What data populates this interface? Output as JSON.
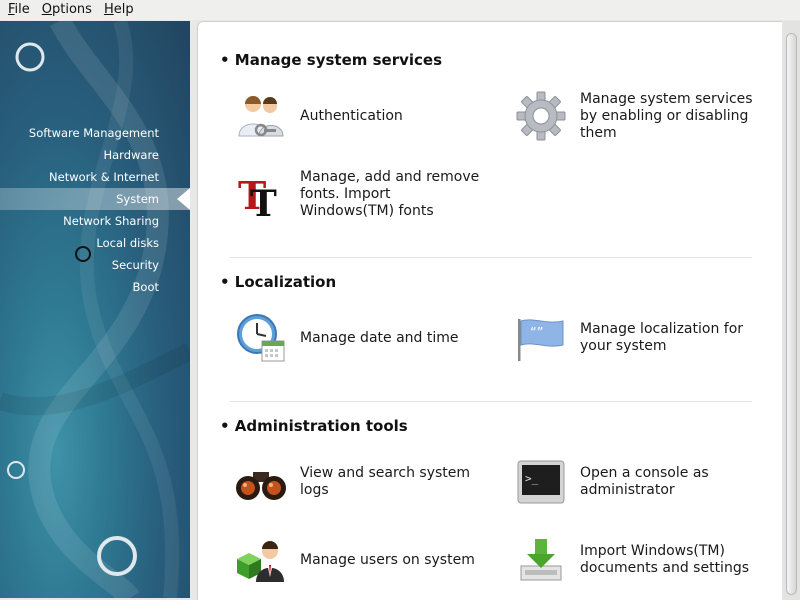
{
  "menubar": {
    "items": [
      {
        "mnemonic": "F",
        "rest": "ile"
      },
      {
        "mnemonic": "O",
        "rest": "ptions"
      },
      {
        "mnemonic": "H",
        "rest": "elp"
      }
    ]
  },
  "sidebar": {
    "items": [
      {
        "label": "Software Management"
      },
      {
        "label": "Hardware"
      },
      {
        "label": "Network & Internet"
      },
      {
        "label": "System",
        "active": true
      },
      {
        "label": "Network Sharing"
      },
      {
        "label": "Local disks"
      },
      {
        "label": "Security"
      },
      {
        "label": "Boot"
      }
    ]
  },
  "sections": [
    {
      "title": "• Manage system services",
      "tools": [
        {
          "label": "Authentication",
          "icon": "users-key-icon"
        },
        {
          "label": "Manage system services by enabling or disabling them",
          "icon": "gear-icon"
        },
        {
          "label": "Manage, add and remove fonts. Import Windows(TM) fonts",
          "icon": "fonts-icon"
        }
      ]
    },
    {
      "title": "• Localization",
      "tools": [
        {
          "label": "Manage date and time",
          "icon": "clock-calendar-icon"
        },
        {
          "label": "Manage localization for your system",
          "icon": "flag-icon"
        }
      ]
    },
    {
      "title": "• Administration tools",
      "tools": [
        {
          "label": "View and search system logs",
          "icon": "binoculars-icon"
        },
        {
          "label": "Open a console as administrator",
          "icon": "terminal-icon"
        },
        {
          "label": "Manage users on system",
          "icon": "user-cube-icon"
        },
        {
          "label": "Import Windows(TM) documents and settings",
          "icon": "download-import-icon"
        }
      ]
    }
  ],
  "colors": {
    "sidebar_dark": "#22445f",
    "sidebar_light": "#3f92a8",
    "panel_bg": "#ffffff",
    "window_bg": "#e8e8e7"
  }
}
